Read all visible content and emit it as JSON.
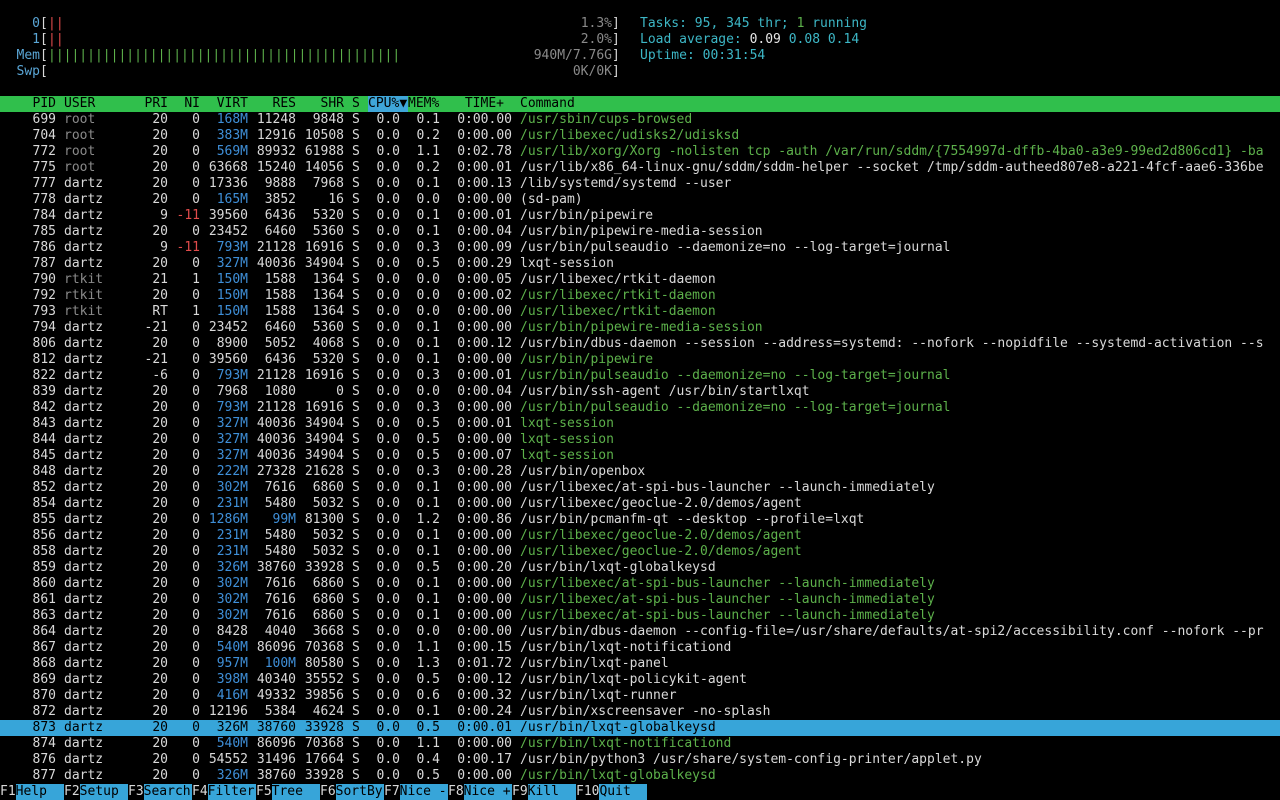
{
  "meters": {
    "cpu0": {
      "label": "0",
      "bar": "||",
      "percent": "1.3%"
    },
    "cpu1": {
      "label": "1",
      "bar": "||",
      "percent": "2.0%"
    },
    "mem": {
      "label": "Mem",
      "bar": "|||||||||||||||||||||||||||||||||||||||||||||",
      "value": "940M/7.76G"
    },
    "swp": {
      "label": "Swp",
      "bar": "",
      "value": "0K/0K"
    }
  },
  "summary": {
    "tasks_label": "Tasks:",
    "tasks_count": "95,",
    "threads_count": "345",
    "threads_label": "thr;",
    "running_count": "1",
    "running_label": "running",
    "load_label": "Load average:",
    "load1": "0.09",
    "load5": "0.08",
    "load15": "0.14",
    "uptime_label": "Uptime:",
    "uptime_value": "00:31:54"
  },
  "columns": {
    "pid": "PID",
    "user": "USER",
    "pri": "PRI",
    "ni": "NI",
    "virt": "VIRT",
    "res": "RES",
    "shr": "SHR",
    "s": "S",
    "cpu": "CPU%",
    "sort_arrow": "▼",
    "mem": "MEM%",
    "time": "TIME+",
    "command": "Command"
  },
  "processes": [
    {
      "pid": "699",
      "user": "root",
      "pri": "20",
      "ni": "0",
      "virt": "168M",
      "res": "11248",
      "shr": "9848",
      "s": "S",
      "cpu": "0.0",
      "mem": "0.1",
      "time": "0:00.00",
      "cmd": "/usr/sbin/cups-browsed",
      "thread": true
    },
    {
      "pid": "704",
      "user": "root",
      "pri": "20",
      "ni": "0",
      "virt": "383M",
      "res": "12916",
      "shr": "10508",
      "s": "S",
      "cpu": "0.0",
      "mem": "0.2",
      "time": "0:00.00",
      "cmd": "/usr/libexec/udisks2/udisksd",
      "thread": true
    },
    {
      "pid": "772",
      "user": "root",
      "pri": "20",
      "ni": "0",
      "virt": "569M",
      "res": "89932",
      "shr": "61988",
      "s": "S",
      "cpu": "0.0",
      "mem": "1.1",
      "time": "0:02.78",
      "cmd": "/usr/lib/xorg/Xorg -nolisten tcp -auth /var/run/sddm/{7554997d-dffb-4ba0-a3e9-99ed2d806cd1} -ba",
      "thread": true
    },
    {
      "pid": "775",
      "user": "root",
      "pri": "20",
      "ni": "0",
      "virt": "63668",
      "res": "15240",
      "shr": "14056",
      "s": "S",
      "cpu": "0.0",
      "mem": "0.2",
      "time": "0:00.01",
      "cmd": "/usr/lib/x86_64-linux-gnu/sddm/sddm-helper --socket /tmp/sddm-autheed807e8-a221-4fcf-aae6-336be",
      "thread": false
    },
    {
      "pid": "777",
      "user": "dartz",
      "pri": "20",
      "ni": "0",
      "virt": "17336",
      "res": "9888",
      "shr": "7968",
      "s": "S",
      "cpu": "0.0",
      "mem": "0.1",
      "time": "0:00.13",
      "cmd": "/lib/systemd/systemd --user",
      "thread": false
    },
    {
      "pid": "778",
      "user": "dartz",
      "pri": "20",
      "ni": "0",
      "virt": "165M",
      "res": "3852",
      "shr": "16",
      "s": "S",
      "cpu": "0.0",
      "mem": "0.0",
      "time": "0:00.00",
      "cmd": "(sd-pam)",
      "thread": false
    },
    {
      "pid": "784",
      "user": "dartz",
      "pri": "9",
      "ni": "-11",
      "virt": "39560",
      "res": "6436",
      "shr": "5320",
      "s": "S",
      "cpu": "0.0",
      "mem": "0.1",
      "time": "0:00.01",
      "cmd": "/usr/bin/pipewire",
      "thread": false
    },
    {
      "pid": "785",
      "user": "dartz",
      "pri": "20",
      "ni": "0",
      "virt": "23452",
      "res": "6460",
      "shr": "5360",
      "s": "S",
      "cpu": "0.0",
      "mem": "0.1",
      "time": "0:00.04",
      "cmd": "/usr/bin/pipewire-media-session",
      "thread": false
    },
    {
      "pid": "786",
      "user": "dartz",
      "pri": "9",
      "ni": "-11",
      "virt": "793M",
      "res": "21128",
      "shr": "16916",
      "s": "S",
      "cpu": "0.0",
      "mem": "0.3",
      "time": "0:00.09",
      "cmd": "/usr/bin/pulseaudio --daemonize=no --log-target=journal",
      "thread": false
    },
    {
      "pid": "787",
      "user": "dartz",
      "pri": "20",
      "ni": "0",
      "virt": "327M",
      "res": "40036",
      "shr": "34904",
      "s": "S",
      "cpu": "0.0",
      "mem": "0.5",
      "time": "0:00.29",
      "cmd": "lxqt-session",
      "thread": false
    },
    {
      "pid": "790",
      "user": "rtkit",
      "pri": "21",
      "ni": "1",
      "virt": "150M",
      "res": "1588",
      "shr": "1364",
      "s": "S",
      "cpu": "0.0",
      "mem": "0.0",
      "time": "0:00.05",
      "cmd": "/usr/libexec/rtkit-daemon",
      "thread": false
    },
    {
      "pid": "792",
      "user": "rtkit",
      "pri": "20",
      "ni": "0",
      "virt": "150M",
      "res": "1588",
      "shr": "1364",
      "s": "S",
      "cpu": "0.0",
      "mem": "0.0",
      "time": "0:00.02",
      "cmd": "/usr/libexec/rtkit-daemon",
      "thread": true
    },
    {
      "pid": "793",
      "user": "rtkit",
      "pri": "RT",
      "ni": "1",
      "virt": "150M",
      "res": "1588",
      "shr": "1364",
      "s": "S",
      "cpu": "0.0",
      "mem": "0.0",
      "time": "0:00.00",
      "cmd": "/usr/libexec/rtkit-daemon",
      "thread": true
    },
    {
      "pid": "794",
      "user": "dartz",
      "pri": "-21",
      "ni": "0",
      "virt": "23452",
      "res": "6460",
      "shr": "5360",
      "s": "S",
      "cpu": "0.0",
      "mem": "0.1",
      "time": "0:00.00",
      "cmd": "/usr/bin/pipewire-media-session",
      "thread": true
    },
    {
      "pid": "806",
      "user": "dartz",
      "pri": "20",
      "ni": "0",
      "virt": "8900",
      "res": "5052",
      "shr": "4068",
      "s": "S",
      "cpu": "0.0",
      "mem": "0.1",
      "time": "0:00.12",
      "cmd": "/usr/bin/dbus-daemon --session --address=systemd: --nofork --nopidfile --systemd-activation --s",
      "thread": false
    },
    {
      "pid": "812",
      "user": "dartz",
      "pri": "-21",
      "ni": "0",
      "virt": "39560",
      "res": "6436",
      "shr": "5320",
      "s": "S",
      "cpu": "0.0",
      "mem": "0.1",
      "time": "0:00.00",
      "cmd": "/usr/bin/pipewire",
      "thread": true
    },
    {
      "pid": "822",
      "user": "dartz",
      "pri": "-6",
      "ni": "0",
      "virt": "793M",
      "res": "21128",
      "shr": "16916",
      "s": "S",
      "cpu": "0.0",
      "mem": "0.3",
      "time": "0:00.01",
      "cmd": "/usr/bin/pulseaudio --daemonize=no --log-target=journal",
      "thread": true
    },
    {
      "pid": "839",
      "user": "dartz",
      "pri": "20",
      "ni": "0",
      "virt": "7968",
      "res": "1080",
      "shr": "0",
      "s": "S",
      "cpu": "0.0",
      "mem": "0.0",
      "time": "0:00.04",
      "cmd": "/usr/bin/ssh-agent /usr/bin/startlxqt",
      "thread": false
    },
    {
      "pid": "842",
      "user": "dartz",
      "pri": "20",
      "ni": "0",
      "virt": "793M",
      "res": "21128",
      "shr": "16916",
      "s": "S",
      "cpu": "0.0",
      "mem": "0.3",
      "time": "0:00.00",
      "cmd": "/usr/bin/pulseaudio --daemonize=no --log-target=journal",
      "thread": true
    },
    {
      "pid": "843",
      "user": "dartz",
      "pri": "20",
      "ni": "0",
      "virt": "327M",
      "res": "40036",
      "shr": "34904",
      "s": "S",
      "cpu": "0.0",
      "mem": "0.5",
      "time": "0:00.01",
      "cmd": "lxqt-session",
      "thread": true
    },
    {
      "pid": "844",
      "user": "dartz",
      "pri": "20",
      "ni": "0",
      "virt": "327M",
      "res": "40036",
      "shr": "34904",
      "s": "S",
      "cpu": "0.0",
      "mem": "0.5",
      "time": "0:00.00",
      "cmd": "lxqt-session",
      "thread": true
    },
    {
      "pid": "845",
      "user": "dartz",
      "pri": "20",
      "ni": "0",
      "virt": "327M",
      "res": "40036",
      "shr": "34904",
      "s": "S",
      "cpu": "0.0",
      "mem": "0.5",
      "time": "0:00.07",
      "cmd": "lxqt-session",
      "thread": true
    },
    {
      "pid": "848",
      "user": "dartz",
      "pri": "20",
      "ni": "0",
      "virt": "222M",
      "res": "27328",
      "shr": "21628",
      "s": "S",
      "cpu": "0.0",
      "mem": "0.3",
      "time": "0:00.28",
      "cmd": "/usr/bin/openbox",
      "thread": false
    },
    {
      "pid": "852",
      "user": "dartz",
      "pri": "20",
      "ni": "0",
      "virt": "302M",
      "res": "7616",
      "shr": "6860",
      "s": "S",
      "cpu": "0.0",
      "mem": "0.1",
      "time": "0:00.00",
      "cmd": "/usr/libexec/at-spi-bus-launcher --launch-immediately",
      "thread": false
    },
    {
      "pid": "854",
      "user": "dartz",
      "pri": "20",
      "ni": "0",
      "virt": "231M",
      "res": "5480",
      "shr": "5032",
      "s": "S",
      "cpu": "0.0",
      "mem": "0.1",
      "time": "0:00.00",
      "cmd": "/usr/libexec/geoclue-2.0/demos/agent",
      "thread": false
    },
    {
      "pid": "855",
      "user": "dartz",
      "pri": "20",
      "ni": "0",
      "virt": "1286M",
      "res": "99M",
      "shr": "81300",
      "s": "S",
      "cpu": "0.0",
      "mem": "1.2",
      "time": "0:00.86",
      "cmd": "/usr/bin/pcmanfm-qt --desktop --profile=lxqt",
      "thread": false
    },
    {
      "pid": "856",
      "user": "dartz",
      "pri": "20",
      "ni": "0",
      "virt": "231M",
      "res": "5480",
      "shr": "5032",
      "s": "S",
      "cpu": "0.0",
      "mem": "0.1",
      "time": "0:00.00",
      "cmd": "/usr/libexec/geoclue-2.0/demos/agent",
      "thread": true
    },
    {
      "pid": "858",
      "user": "dartz",
      "pri": "20",
      "ni": "0",
      "virt": "231M",
      "res": "5480",
      "shr": "5032",
      "s": "S",
      "cpu": "0.0",
      "mem": "0.1",
      "time": "0:00.00",
      "cmd": "/usr/libexec/geoclue-2.0/demos/agent",
      "thread": true
    },
    {
      "pid": "859",
      "user": "dartz",
      "pri": "20",
      "ni": "0",
      "virt": "326M",
      "res": "38760",
      "shr": "33928",
      "s": "S",
      "cpu": "0.0",
      "mem": "0.5",
      "time": "0:00.20",
      "cmd": "/usr/bin/lxqt-globalkeysd",
      "thread": false
    },
    {
      "pid": "860",
      "user": "dartz",
      "pri": "20",
      "ni": "0",
      "virt": "302M",
      "res": "7616",
      "shr": "6860",
      "s": "S",
      "cpu": "0.0",
      "mem": "0.1",
      "time": "0:00.00",
      "cmd": "/usr/libexec/at-spi-bus-launcher --launch-immediately",
      "thread": true
    },
    {
      "pid": "861",
      "user": "dartz",
      "pri": "20",
      "ni": "0",
      "virt": "302M",
      "res": "7616",
      "shr": "6860",
      "s": "S",
      "cpu": "0.0",
      "mem": "0.1",
      "time": "0:00.00",
      "cmd": "/usr/libexec/at-spi-bus-launcher --launch-immediately",
      "thread": true
    },
    {
      "pid": "863",
      "user": "dartz",
      "pri": "20",
      "ni": "0",
      "virt": "302M",
      "res": "7616",
      "shr": "6860",
      "s": "S",
      "cpu": "0.0",
      "mem": "0.1",
      "time": "0:00.00",
      "cmd": "/usr/libexec/at-spi-bus-launcher --launch-immediately",
      "thread": true
    },
    {
      "pid": "864",
      "user": "dartz",
      "pri": "20",
      "ni": "0",
      "virt": "8428",
      "res": "4040",
      "shr": "3668",
      "s": "S",
      "cpu": "0.0",
      "mem": "0.0",
      "time": "0:00.00",
      "cmd": "/usr/bin/dbus-daemon --config-file=/usr/share/defaults/at-spi2/accessibility.conf --nofork --pr",
      "thread": false
    },
    {
      "pid": "867",
      "user": "dartz",
      "pri": "20",
      "ni": "0",
      "virt": "540M",
      "res": "86096",
      "shr": "70368",
      "s": "S",
      "cpu": "0.0",
      "mem": "1.1",
      "time": "0:00.15",
      "cmd": "/usr/bin/lxqt-notificationd",
      "thread": false
    },
    {
      "pid": "868",
      "user": "dartz",
      "pri": "20",
      "ni": "0",
      "virt": "957M",
      "res": "100M",
      "shr": "80580",
      "s": "S",
      "cpu": "0.0",
      "mem": "1.3",
      "time": "0:01.72",
      "cmd": "/usr/bin/lxqt-panel",
      "thread": false
    },
    {
      "pid": "869",
      "user": "dartz",
      "pri": "20",
      "ni": "0",
      "virt": "398M",
      "res": "40340",
      "shr": "35552",
      "s": "S",
      "cpu": "0.0",
      "mem": "0.5",
      "time": "0:00.12",
      "cmd": "/usr/bin/lxqt-policykit-agent",
      "thread": false
    },
    {
      "pid": "870",
      "user": "dartz",
      "pri": "20",
      "ni": "0",
      "virt": "416M",
      "res": "49332",
      "shr": "39856",
      "s": "S",
      "cpu": "0.0",
      "mem": "0.6",
      "time": "0:00.32",
      "cmd": "/usr/bin/lxqt-runner",
      "thread": false
    },
    {
      "pid": "872",
      "user": "dartz",
      "pri": "20",
      "ni": "0",
      "virt": "12196",
      "res": "5384",
      "shr": "4624",
      "s": "S",
      "cpu": "0.0",
      "mem": "0.1",
      "time": "0:00.24",
      "cmd": "/usr/bin/xscreensaver -no-splash",
      "thread": false
    },
    {
      "pid": "873",
      "user": "dartz",
      "pri": "20",
      "ni": "0",
      "virt": "326M",
      "res": "38760",
      "shr": "33928",
      "s": "S",
      "cpu": "0.0",
      "mem": "0.5",
      "time": "0:00.01",
      "cmd": "/usr/bin/lxqt-globalkeysd",
      "thread": true,
      "selected": true
    },
    {
      "pid": "874",
      "user": "dartz",
      "pri": "20",
      "ni": "0",
      "virt": "540M",
      "res": "86096",
      "shr": "70368",
      "s": "S",
      "cpu": "0.0",
      "mem": "1.1",
      "time": "0:00.00",
      "cmd": "/usr/bin/lxqt-notificationd",
      "thread": true
    },
    {
      "pid": "876",
      "user": "dartz",
      "pri": "20",
      "ni": "0",
      "virt": "54552",
      "res": "31496",
      "shr": "17664",
      "s": "S",
      "cpu": "0.0",
      "mem": "0.4",
      "time": "0:00.17",
      "cmd": "/usr/bin/python3 /usr/share/system-config-printer/applet.py",
      "thread": false
    },
    {
      "pid": "877",
      "user": "dartz",
      "pri": "20",
      "ni": "0",
      "virt": "326M",
      "res": "38760",
      "shr": "33928",
      "s": "S",
      "cpu": "0.0",
      "mem": "0.5",
      "time": "0:00.00",
      "cmd": "/usr/bin/lxqt-globalkeysd",
      "thread": true
    }
  ],
  "footer": [
    {
      "key": "F1",
      "label": "Help"
    },
    {
      "key": "F2",
      "label": "Setup"
    },
    {
      "key": "F3",
      "label": "Search"
    },
    {
      "key": "F4",
      "label": "Filter"
    },
    {
      "key": "F5",
      "label": "Tree"
    },
    {
      "key": "F6",
      "label": "SortBy"
    },
    {
      "key": "F7",
      "label": "Nice -"
    },
    {
      "key": "F8",
      "label": "Nice +"
    },
    {
      "key": "F9",
      "label": "Kill"
    },
    {
      "key": "F10",
      "label": "Quit"
    }
  ],
  "colors": {
    "header_bg": "#30bf4c",
    "selected_bg": "#37a5d9",
    "footer_label_bg": "#37a5d9",
    "thread_cmd": "#5db14b",
    "nice_negative": "#e04b4b",
    "large_num": "#3f8fd8"
  }
}
